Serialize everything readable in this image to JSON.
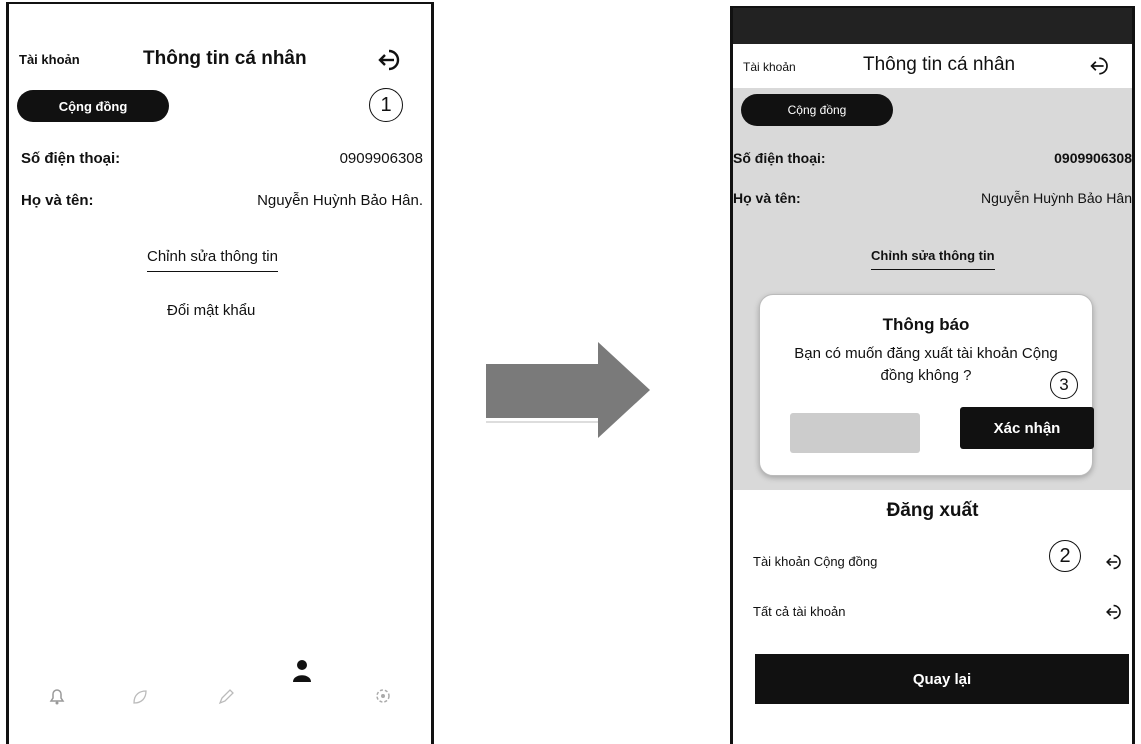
{
  "screen_before": {
    "header": {
      "left_label": "Tài khoản",
      "title": "Thông tin cá nhân",
      "logout_icon": "logout-icon"
    },
    "community_pill": "Cộng đồng",
    "step_marker": "1",
    "phone_label": "Số điện thoại:",
    "phone_value": "0909906308",
    "name_label": "Họ và tên:",
    "name_value": "Nguyễn Huỳnh Bảo Hân.",
    "edit_link": "Chỉnh sửa thông tin",
    "change_password_link": "Đổi mật khẩu",
    "nav_icons": [
      "bell-icon",
      "leaf-icon",
      "pen-icon",
      "user-icon",
      "settings-icon"
    ]
  },
  "transition_arrow": "arrow-right-icon",
  "screen_after": {
    "header": {
      "left_label": "Tài khoản",
      "title": "Thông tin cá nhân",
      "logout_icon": "logout-icon"
    },
    "community_pill": "Cộng đồng",
    "phone_label": "Số điện thoại:",
    "phone_value": "0909906308",
    "name_label": "Họ và tên:",
    "name_value": "Nguyễn Huỳnh Bảo Hân",
    "edit_link": "Chỉnh sửa thông tin",
    "dialog": {
      "title": "Thông báo",
      "message": "Bạn có muốn đăng xuất tài khoản Cộng đồng không ?",
      "confirm_label": "Xác nhận",
      "step_marker": "3"
    },
    "logout_sheet": {
      "title": "Đăng xuất",
      "items": [
        {
          "label": "Tài khoản Cộng đồng",
          "icon": "logout-icon"
        },
        {
          "label": "Tất cả tài khoản",
          "icon": "logout-icon"
        }
      ],
      "step_marker": "2",
      "back_label": "Quay lại"
    }
  }
}
